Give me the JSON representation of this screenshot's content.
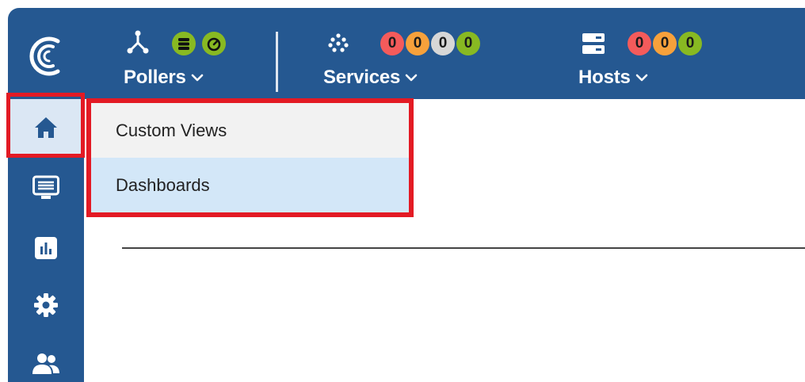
{
  "header": {
    "pollers": {
      "label": "Pollers",
      "icons": [
        "poller-tree-icon",
        "database-status-icon",
        "gauge-status-icon"
      ]
    },
    "services": {
      "label": "Services",
      "icon": "services-grid-icon",
      "counters": [
        {
          "name": "critical",
          "value": "0",
          "color": "#f45b5b"
        },
        {
          "name": "warning",
          "value": "0",
          "color": "#f7a13b"
        },
        {
          "name": "unknown",
          "value": "0",
          "color": "#d7d7d7"
        },
        {
          "name": "ok",
          "value": "0",
          "color": "#88b922"
        }
      ]
    },
    "hosts": {
      "label": "Hosts",
      "icon": "hosts-server-icon",
      "counters": [
        {
          "name": "down",
          "value": "0",
          "color": "#f45b5b"
        },
        {
          "name": "unreachable",
          "value": "0",
          "color": "#f7a13b"
        },
        {
          "name": "up",
          "value": "0",
          "color": "#88b922"
        }
      ]
    }
  },
  "sidebar": {
    "items": [
      {
        "name": "home",
        "icon": "home-icon",
        "active": true
      },
      {
        "name": "monitoring",
        "icon": "monitor-list-icon"
      },
      {
        "name": "reporting",
        "icon": "bar-chart-icon"
      },
      {
        "name": "configuration",
        "icon": "gear-icon"
      },
      {
        "name": "administration",
        "icon": "users-icon"
      }
    ]
  },
  "menu": {
    "items": [
      "Custom Views",
      "Dashboards"
    ]
  },
  "colors": {
    "brand_blue": "#255891",
    "highlight_red": "#e31a24",
    "selected_item": "#d3e7f8"
  }
}
